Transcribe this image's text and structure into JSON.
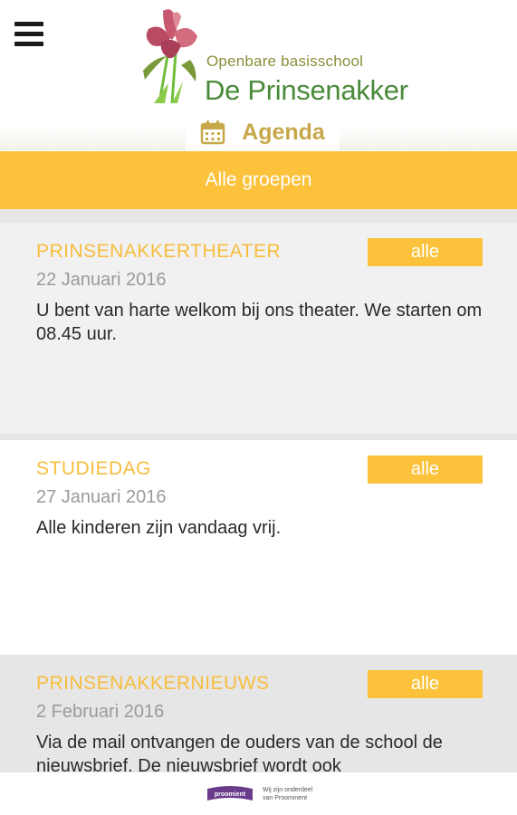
{
  "header": {
    "menu_icon": "hamburger-menu-icon",
    "logo": {
      "subtitle": "Openbare  basisschool",
      "name": "De Prinsenakker"
    },
    "section_icon": "calendar-icon",
    "section_title": "Agenda"
  },
  "filter": {
    "label": "Alle groepen"
  },
  "agenda": {
    "items": [
      {
        "title": "PRINSENAKKERTHEATER",
        "group": "alle",
        "date": "22 Januari 2016",
        "text": "U bent van harte welkom bij ons theater. We starten om 08.45 uur."
      },
      {
        "title": "STUDIEDAG",
        "group": "alle",
        "date": "27 Januari 2016",
        "text": "Alle kinderen zijn vandaag vrij."
      },
      {
        "title": "PRINSENAKKERNIEUWS",
        "group": "alle",
        "date": "2 Februari 2016",
        "text": "Via de mail ontvangen de ouders van de school de nieuwsbrief. De nieuwsbrief wordt ook"
      }
    ]
  },
  "footer": {
    "logo_text": "proomient",
    "tagline_1": "Wij zijn onderdeel",
    "tagline_2": "van Proominent"
  },
  "colors": {
    "accent": "#fcc23b",
    "title": "#f7bd3d",
    "agenda_label": "#c6a84a",
    "logo_green": "#4a8a3a"
  }
}
